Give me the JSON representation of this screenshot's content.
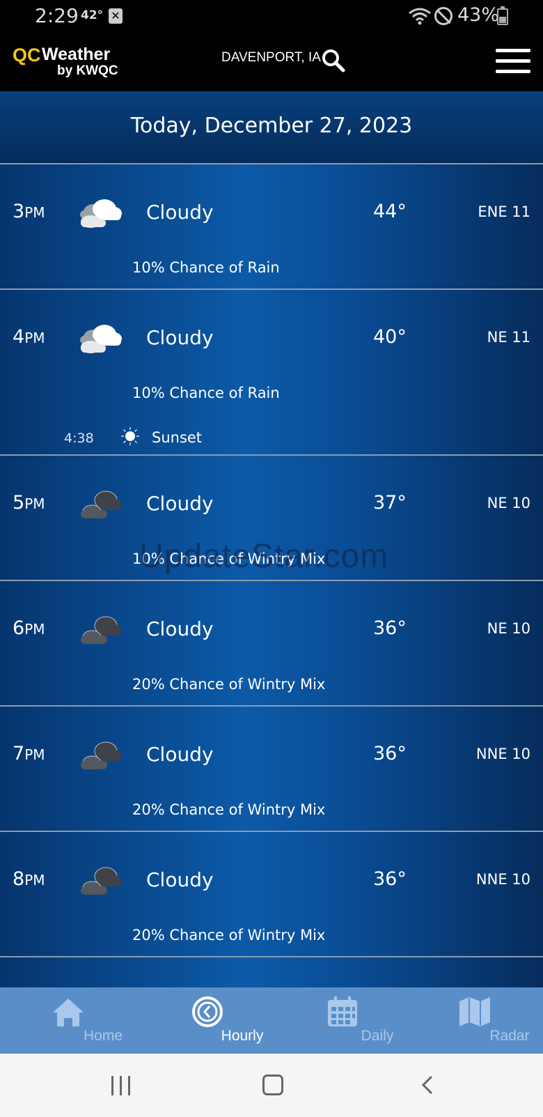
{
  "status_bar": {
    "time": "2:29",
    "temp": "42°",
    "battery": "43%"
  },
  "header": {
    "logo_qc": "QC",
    "logo_weather": "Weather",
    "logo_by": "by KWQC",
    "location": "DAVENPORT, IA"
  },
  "date_title": "Today, December 27, 2023",
  "hours": [
    {
      "hour": "3",
      "ampm": "PM",
      "icon": "partly-cloudy-icon",
      "condition": "Cloudy",
      "temp": "44°",
      "wind": "ENE 11",
      "precip": "10% Chance of Rain"
    },
    {
      "hour": "4",
      "ampm": "PM",
      "icon": "partly-cloudy-icon",
      "condition": "Cloudy",
      "temp": "40°",
      "wind": "NE 11",
      "precip": "10% Chance of Rain",
      "sunset_time": "4:38",
      "sunset_label": "Sunset"
    },
    {
      "hour": "5",
      "ampm": "PM",
      "icon": "dark-cloud-icon",
      "condition": "Cloudy",
      "temp": "37°",
      "wind": "NE 10",
      "precip": "10% Chance of Wintry Mix"
    },
    {
      "hour": "6",
      "ampm": "PM",
      "icon": "dark-cloud-icon",
      "condition": "Cloudy",
      "temp": "36°",
      "wind": "NE 10",
      "precip": "20% Chance of Wintry Mix"
    },
    {
      "hour": "7",
      "ampm": "PM",
      "icon": "dark-cloud-icon",
      "condition": "Cloudy",
      "temp": "36°",
      "wind": "NNE 10",
      "precip": "20% Chance of Wintry Mix"
    },
    {
      "hour": "8",
      "ampm": "PM",
      "icon": "dark-cloud-icon",
      "condition": "Cloudy",
      "temp": "36°",
      "wind": "NNE 10",
      "precip": "20% Chance of Wintry Mix"
    }
  ],
  "watermark": "UpdateStar.com",
  "nav": {
    "home": "Home",
    "hourly": "Hourly",
    "daily": "Daily",
    "radar": "Radar",
    "active": "hourly"
  },
  "colors": {
    "accent_logo": "#f5c518",
    "nav_bg": "#5a8ec8",
    "nav_inactive": "#a9c8ec"
  }
}
